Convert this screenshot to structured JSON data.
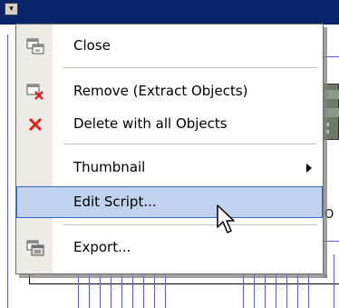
{
  "menu": {
    "items": [
      {
        "label": "Close",
        "icon": "close-window-icon"
      },
      {
        "label": "Remove (Extract Objects)",
        "icon": "remove-extract-icon"
      },
      {
        "label": "Delete with all Objects",
        "icon": "delete-x-icon"
      },
      {
        "label": "Thumbnail",
        "icon": "",
        "submenu": true
      },
      {
        "label": "Edit Script...",
        "icon": "",
        "highlighted": true
      },
      {
        "label": "Export...",
        "icon": "export-icon"
      }
    ]
  },
  "background": {
    "edge_text": "O"
  },
  "colors": {
    "titlebar": "#0a246a",
    "highlight_fill": "#c1d2ee",
    "highlight_border": "#316ac5",
    "delete_icon": "#e02020"
  }
}
